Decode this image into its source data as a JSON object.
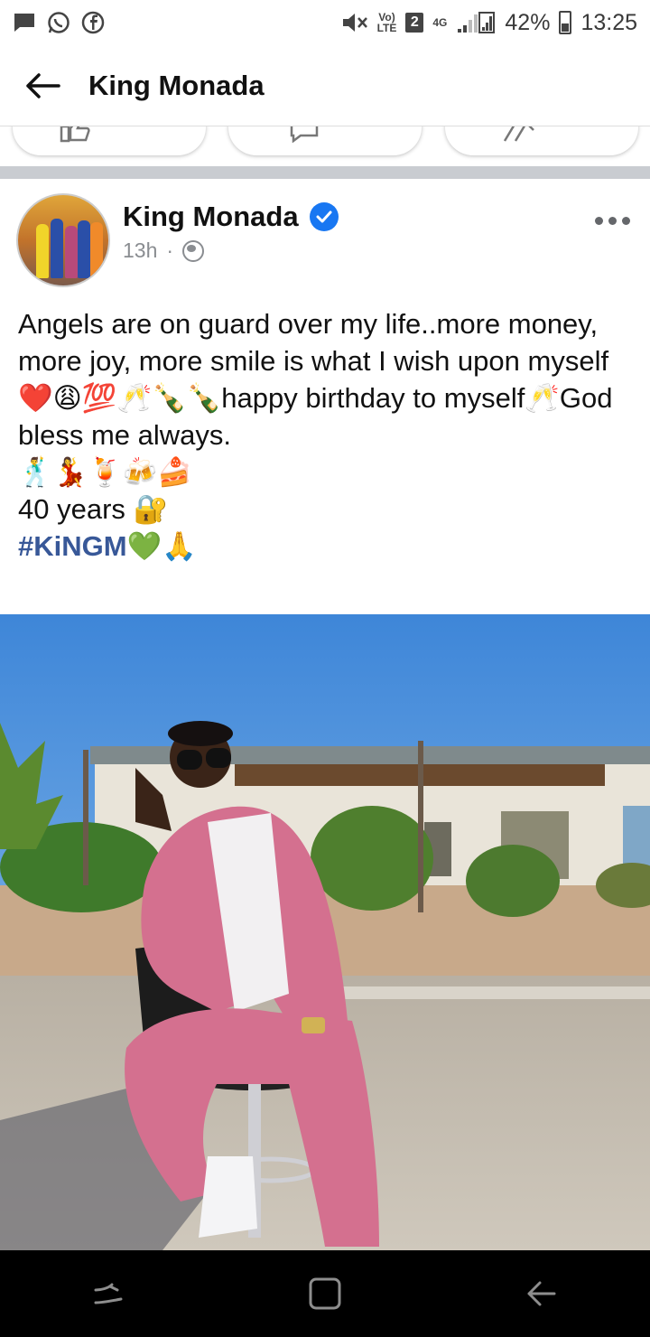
{
  "status_bar": {
    "network_label_top": "Vo)",
    "network_label_bottom": "LTE",
    "sim_slot": "2",
    "signal_label": "4G",
    "battery_percent": "42%",
    "time": "13:25"
  },
  "header": {
    "title": "King Monada"
  },
  "post": {
    "author": "King Monada",
    "time_ago": "13h",
    "separator": "·",
    "text_lines": [
      "Angels are on guard over my life..more money, more joy, more smile is what I wish upon myself❤️😩💯🥂🍾🍾happy birthday to myself🥂God bless me always.",
      "🕺💃🍹🍻🍰",
      "40 years 🔐",
      ""
    ],
    "hashtag": "#KiNGM",
    "hashtag_suffix": "💚🙏"
  },
  "colors": {
    "accent": "#1877f2",
    "hashtag": "#385898",
    "meta_gray": "#8a8d91",
    "divider": "#c9ccd1"
  },
  "icons": {
    "back": "arrow-left-icon",
    "verified": "verified-badge-icon",
    "audience": "globe-icon",
    "more": "more-dots-icon"
  }
}
